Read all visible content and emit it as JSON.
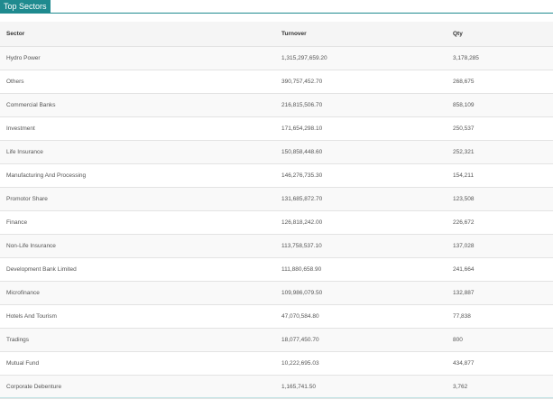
{
  "panel": {
    "tab_label": "Top Sectors"
  },
  "table": {
    "headers": {
      "sector": "Sector",
      "turnover": "Turnover",
      "qty": "Qty"
    },
    "rows": [
      {
        "sector": "Hydro Power",
        "turnover": "1,315,297,659.20",
        "qty": "3,178,285"
      },
      {
        "sector": "Others",
        "turnover": "390,757,452.70",
        "qty": "268,675"
      },
      {
        "sector": "Commercial Banks",
        "turnover": "216,815,506.70",
        "qty": "858,109"
      },
      {
        "sector": "Investment",
        "turnover": "171,654,298.10",
        "qty": "250,537"
      },
      {
        "sector": "Life Insurance",
        "turnover": "150,858,448.60",
        "qty": "252,321"
      },
      {
        "sector": "Manufacturing And Processing",
        "turnover": "146,276,735.30",
        "qty": "154,211"
      },
      {
        "sector": "Promotor Share",
        "turnover": "131,685,872.70",
        "qty": "123,508"
      },
      {
        "sector": "Finance",
        "turnover": "126,818,242.00",
        "qty": "226,672"
      },
      {
        "sector": "Non-Life Insurance",
        "turnover": "113,758,537.10",
        "qty": "137,028"
      },
      {
        "sector": "Development Bank Limited",
        "turnover": "111,880,658.90",
        "qty": "241,664"
      },
      {
        "sector": "Microfinance",
        "turnover": "109,986,079.50",
        "qty": "132,887"
      },
      {
        "sector": "Hotels And Tourism",
        "turnover": "47,070,584.80",
        "qty": "77,838"
      },
      {
        "sector": "Tradings",
        "turnover": "18,077,450.70",
        "qty": "800"
      },
      {
        "sector": "Mutual Fund",
        "turnover": "10,222,695.03",
        "qty": "434,877"
      },
      {
        "sector": "Corporate Debenture",
        "turnover": "1,165,741.50",
        "qty": "3,762"
      }
    ]
  }
}
